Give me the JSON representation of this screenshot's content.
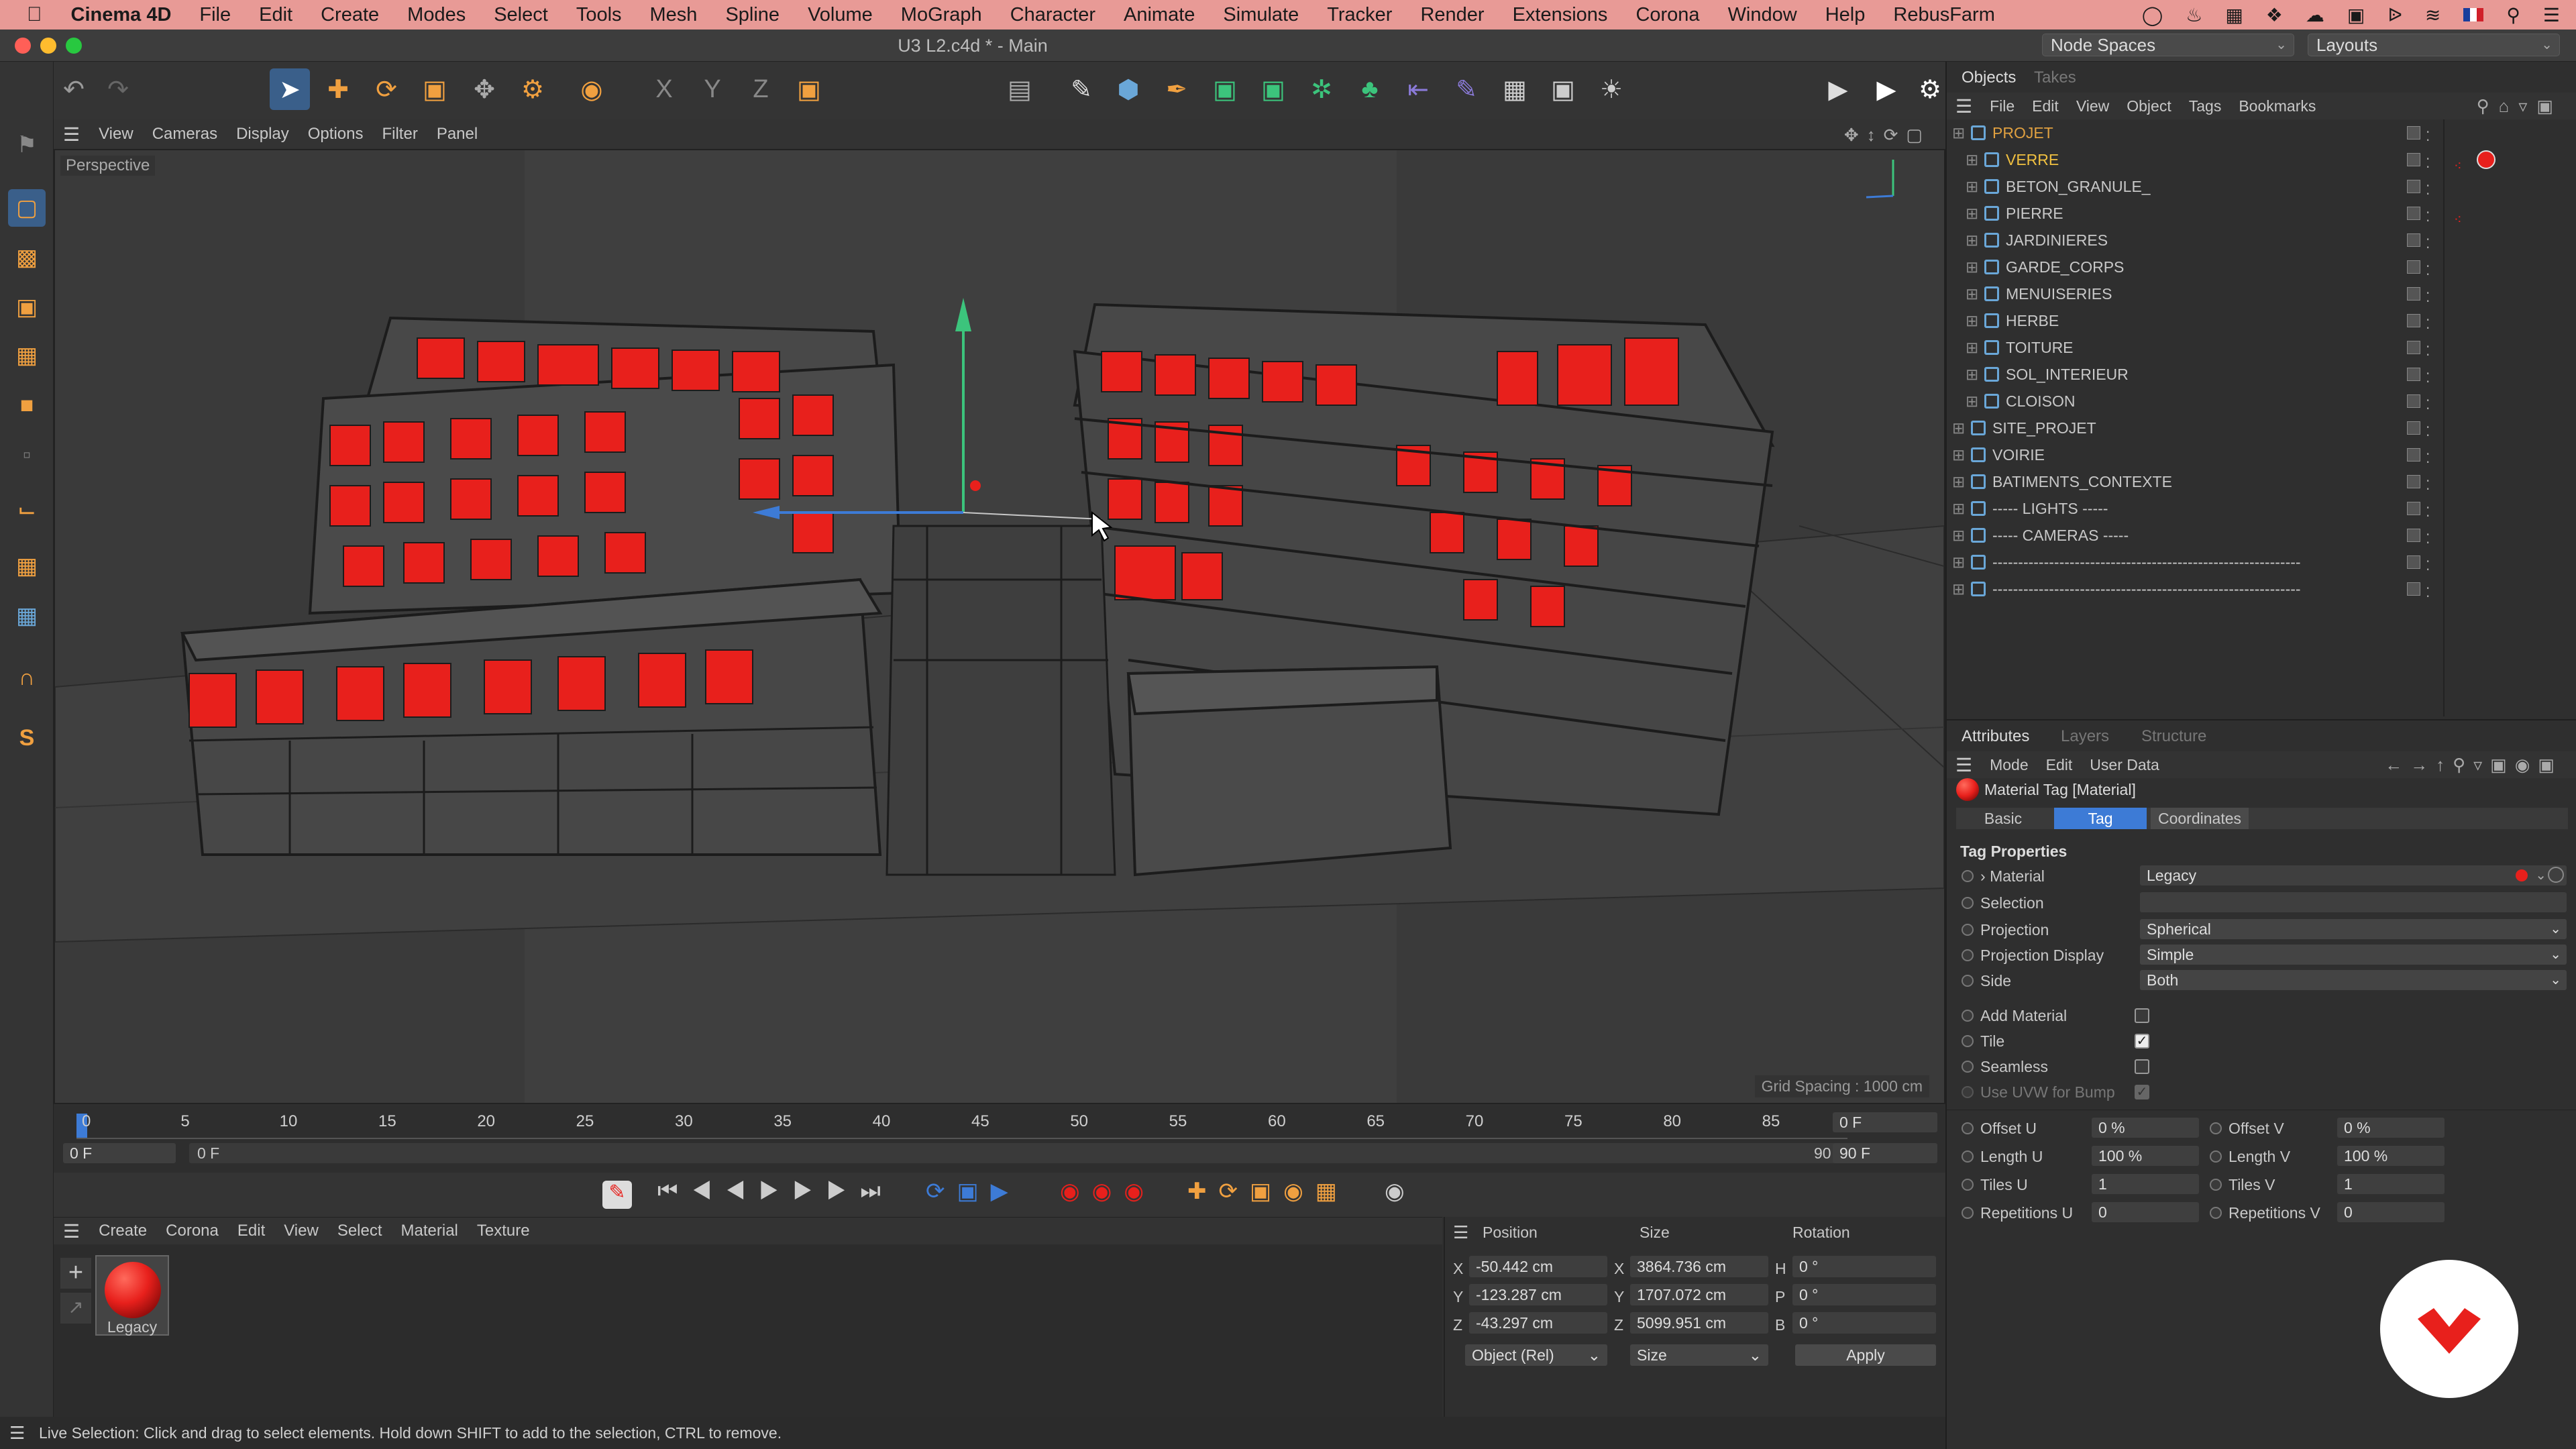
{
  "menubar": {
    "apple": "",
    "app": "Cinema 4D",
    "items": [
      "File",
      "Edit",
      "Create",
      "Modes",
      "Select",
      "Tools",
      "Mesh",
      "Spline",
      "Volume",
      "MoGraph",
      "Character",
      "Animate",
      "Simulate",
      "Tracker",
      "Render",
      "Extensions",
      "Corona",
      "Window",
      "Help",
      "RebusFarm"
    ]
  },
  "window": {
    "title": "U3 L2.c4d * - Main",
    "node_spaces": "Node Spaces",
    "layouts": "Layouts"
  },
  "viewport": {
    "menu": [
      "View",
      "Cameras",
      "Display",
      "Options",
      "Filter",
      "Panel"
    ],
    "label": "Perspective",
    "grid_spacing": "Grid Spacing : 1000 cm"
  },
  "timeline": {
    "ticks": [
      "0",
      "5",
      "10",
      "15",
      "20",
      "25",
      "30",
      "35",
      "40",
      "45",
      "50",
      "55",
      "60",
      "65",
      "70",
      "75",
      "80",
      "85",
      "90"
    ],
    "current_frame": "0 F",
    "start": "0 F",
    "range_start": "0 F",
    "range_end": "90 F",
    "end": "90 F"
  },
  "material_manager": {
    "menu": [
      "Create",
      "Corona",
      "Edit",
      "View",
      "Select",
      "Material",
      "Texture"
    ],
    "material_name": "Legacy"
  },
  "coordinates": {
    "headers": [
      "Position",
      "Size",
      "Rotation"
    ],
    "axes": [
      "X",
      "Y",
      "Z"
    ],
    "rot_axes": [
      "H",
      "P",
      "B"
    ],
    "position": [
      "-50.442 cm",
      "-123.287 cm",
      "-43.297 cm"
    ],
    "size": [
      "3864.736 cm",
      "1707.072 cm",
      "5099.951 cm"
    ],
    "rotation": [
      "0 °",
      "0 °",
      "0 °"
    ],
    "mode": "Object (Rel)",
    "size_mode": "Size",
    "apply": "Apply"
  },
  "status": "Live Selection: Click and drag to select elements. Hold down SHIFT to add to the selection, CTRL to remove.",
  "objects_panel": {
    "tabs": [
      "Objects",
      "Takes"
    ],
    "menu": [
      "File",
      "Edit",
      "View",
      "Object",
      "Tags",
      "Bookmarks"
    ],
    "rows": [
      {
        "name": "PROJET",
        "level": 0,
        "color": "#e0a040"
      },
      {
        "name": "VERRE",
        "level": 1,
        "color": "#f0c040"
      },
      {
        "name": "BETON_GRANULE_",
        "level": 1,
        "color": "#c8c8c8"
      },
      {
        "name": "PIERRE",
        "level": 1,
        "color": "#c8c8c8"
      },
      {
        "name": "JARDINIERES",
        "level": 1,
        "color": "#c8c8c8"
      },
      {
        "name": "GARDE_CORPS",
        "level": 1,
        "color": "#c8c8c8"
      },
      {
        "name": "MENUISERIES",
        "level": 1,
        "color": "#c8c8c8"
      },
      {
        "name": "HERBE",
        "level": 1,
        "color": "#c8c8c8"
      },
      {
        "name": "TOITURE",
        "level": 1,
        "color": "#c8c8c8"
      },
      {
        "name": "SOL_INTERIEUR",
        "level": 1,
        "color": "#c8c8c8"
      },
      {
        "name": "CLOISON",
        "level": 1,
        "color": "#c8c8c8"
      },
      {
        "name": "SITE_PROJET",
        "level": 0,
        "color": "#c8c8c8"
      },
      {
        "name": "VOIRIE",
        "level": 0,
        "color": "#c8c8c8"
      },
      {
        "name": "BATIMENTS_CONTEXTE",
        "level": 0,
        "color": "#c8c8c8"
      },
      {
        "name": "----- LIGHTS -----",
        "level": 0,
        "color": "#c8c8c8"
      },
      {
        "name": "----- CAMERAS -----",
        "level": 0,
        "color": "#c8c8c8"
      },
      {
        "name": "------------------------------------------------------------",
        "level": 0,
        "color": "#c8c8c8"
      },
      {
        "name": "------------------------------------------------------------",
        "level": 0,
        "color": "#c8c8c8"
      }
    ]
  },
  "attributes": {
    "tabs": [
      "Attributes",
      "Layers",
      "Structure"
    ],
    "menu": [
      "Mode",
      "Edit",
      "User Data"
    ],
    "title": "Material Tag [Material]",
    "subtabs": [
      "Basic",
      "Tag",
      "Coordinates"
    ],
    "section": "Tag Properties",
    "material_label": "Material",
    "material_value": "Legacy",
    "selection_label": "Selection",
    "projection_label": "Projection",
    "projection_value": "Spherical",
    "projection_display_label": "Projection Display",
    "projection_display_value": "Simple",
    "side_label": "Side",
    "side_value": "Both",
    "add_material_label": "Add Material",
    "tile_label": "Tile",
    "seamless_label": "Seamless",
    "uvw_bump_label": "Use UVW for Bump",
    "offset_u_label": "Offset U",
    "offset_u": "0 %",
    "offset_v_label": "Offset V",
    "offset_v": "0 %",
    "length_u_label": "Length U",
    "length_u": "100 %",
    "length_v_label": "Length V",
    "length_v": "100 %",
    "tiles_u_label": "Tiles U",
    "tiles_u": "1",
    "tiles_v_label": "Tiles V",
    "tiles_v": "1",
    "rep_u_label": "Repetitions U",
    "rep_u": "0",
    "rep_v_label": "Repetitions V",
    "rep_v": "0"
  },
  "colors": {
    "accent": "#3d7bd6",
    "menubar": "#e89a96",
    "glass": "#e8201c",
    "logo": "#e8201c"
  }
}
